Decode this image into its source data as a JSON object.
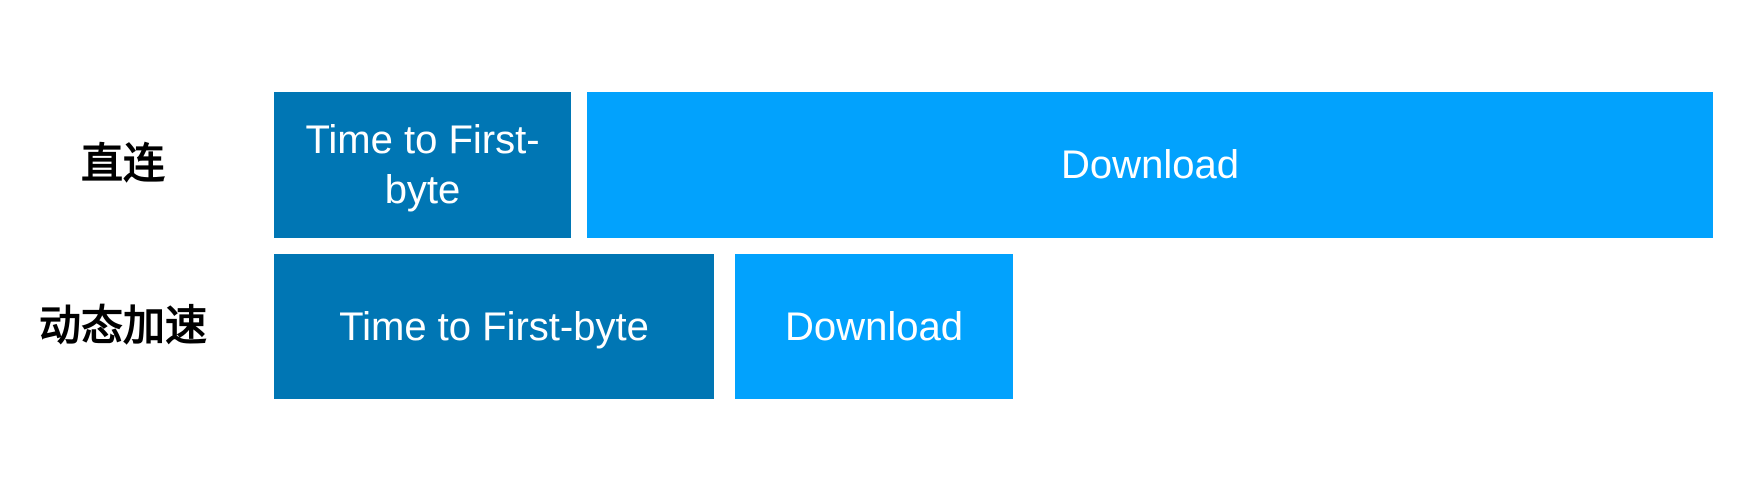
{
  "rows": [
    {
      "label": "直连",
      "segments": [
        {
          "label": "Time to First-byte"
        },
        {
          "label": "Download"
        }
      ]
    },
    {
      "label": "动态加速",
      "segments": [
        {
          "label": "Time to First-byte"
        },
        {
          "label": "Download"
        }
      ]
    }
  ],
  "colors": {
    "time_to_first_byte": "#0076B4",
    "download": "#02A2FD",
    "label_text": "#000000",
    "block_text": "#FFFFFF"
  }
}
